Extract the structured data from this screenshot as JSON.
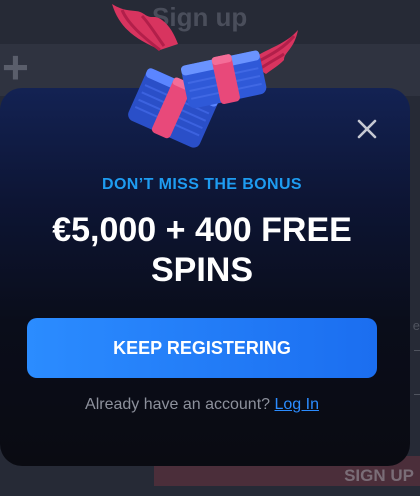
{
  "background": {
    "title": "Sign up",
    "plus": "+",
    "signup_button": "SIGN UP",
    "side_text": "e"
  },
  "modal": {
    "subtitle": "DON’T MISS THE BONUS",
    "headline": "€5,000 + 400 FREE SPINS",
    "cta_label": "KEEP REGISTERING",
    "account_prompt": "Already have an account?",
    "login_link": "Log In"
  },
  "icons": {
    "close": "close-icon",
    "hero": "winged-money-icon"
  },
  "colors": {
    "accent_blue": "#1e9cf1",
    "button_blue": "#2b8cff",
    "modal_bg": "#0a0b12",
    "wing_pink": "#e63c74"
  }
}
